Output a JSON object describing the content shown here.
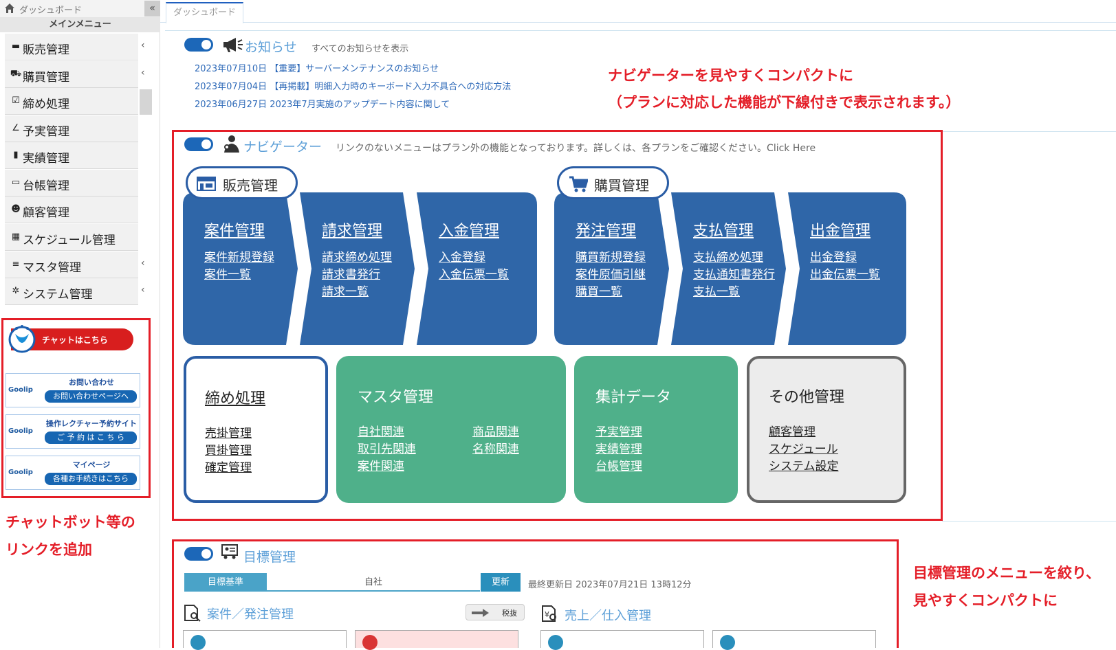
{
  "sidebar": {
    "title": "ダッシュボード",
    "collapse": "«",
    "menu_header": "メインメニュー",
    "items": [
      {
        "label": "販売管理",
        "icon": "sales-icon",
        "glyph": "▬",
        "arrow": "‹"
      },
      {
        "label": "購買管理",
        "icon": "cart-icon",
        "glyph": "⛟",
        "arrow": "‹"
      },
      {
        "label": "締め処理",
        "icon": "checkbox-icon",
        "glyph": "☑",
        "arrow": ""
      },
      {
        "label": "予実管理",
        "icon": "line-chart-icon",
        "glyph": "∠",
        "arrow": ""
      },
      {
        "label": "実績管理",
        "icon": "bookmark-icon",
        "glyph": "▮",
        "arrow": ""
      },
      {
        "label": "台帳管理",
        "icon": "ledger-icon",
        "glyph": "▭",
        "arrow": ""
      },
      {
        "label": "顧客管理",
        "icon": "users-icon",
        "glyph": "☻",
        "arrow": ""
      },
      {
        "label": "スケジュール管理",
        "icon": "calendar-icon",
        "glyph": "▦",
        "arrow": ""
      },
      {
        "label": "マスタ管理",
        "icon": "database-icon",
        "glyph": "≡",
        "arrow": "‹"
      },
      {
        "label": "システム管理",
        "icon": "gear-icon",
        "glyph": "✲",
        "arrow": "‹"
      }
    ],
    "chat_button": "チャットはこちら",
    "goolip": [
      {
        "logo": "Goolip",
        "title": "お問い合わせ",
        "button": "お問い合わせページへ"
      },
      {
        "logo": "Goolip",
        "title": "操作レクチャー予約サイト",
        "button": "ご 予 約 は こ ち ら"
      },
      {
        "logo": "Goolip",
        "title": "マイページ",
        "button": "各種お手続きはこちら"
      }
    ],
    "annotation_lines": [
      "チャットボット等の",
      "リンクを追加"
    ]
  },
  "tabs": {
    "dashboard": "ダッシュボード"
  },
  "notices": {
    "title": "お知らせ",
    "show_all": "すべてのお知らせを表示",
    "items": [
      "2023年07月10日 【重要】サーバーメンテナンスのお知らせ",
      "2023年07月04日 【再掲載】明細入力時のキーボード入力不具合への対応方法",
      "2023年06月27日 2023年7月実施のアップデート内容に関して"
    ]
  },
  "annotation_navigator": [
    "ナビゲーターを見やすくコンパクトに",
    "（プランに対応した機能が下線付きで表示されます。）"
  ],
  "navigator": {
    "title": "ナビゲーター",
    "note": "リンクのないメニューはプラン外の機能となっております。詳しくは、各プランをご確認ください。Click Here",
    "sales": {
      "label": "販売管理",
      "steps": [
        {
          "title": "案件管理",
          "links": [
            "案件新規登録",
            "案件一覧"
          ]
        },
        {
          "title": "請求管理",
          "links": [
            "請求締め処理",
            "請求書発行",
            "請求一覧"
          ]
        },
        {
          "title": "入金管理",
          "links": [
            "入金登録",
            "入金伝票一覧"
          ]
        }
      ]
    },
    "purchase": {
      "label": "購買管理",
      "steps": [
        {
          "title": "発注管理",
          "links": [
            "購買新規登録",
            "案件原価引継",
            "購買一覧"
          ]
        },
        {
          "title": "支払管理",
          "links": [
            "支払締め処理",
            "支払通知書発行",
            "支払一覧"
          ]
        },
        {
          "title": "出金管理",
          "links": [
            "出金登録",
            "出金伝票一覧"
          ]
        }
      ]
    },
    "cards": {
      "closing": {
        "title": "締め処理",
        "links": [
          "売掛管理",
          "買掛管理",
          "確定管理"
        ]
      },
      "master": {
        "title": "マスタ管理",
        "links": [
          "自社関連",
          "取引先関連",
          "案件関連",
          "商品関連",
          "名称関連"
        ]
      },
      "aggregate": {
        "title": "集計データ",
        "links": [
          "予実管理",
          "実績管理",
          "台帳管理"
        ]
      },
      "other": {
        "title": "その他管理",
        "links": [
          "顧客管理",
          "スケジュール",
          "システム設定"
        ]
      }
    }
  },
  "goals": {
    "title": "目標管理",
    "basis_label": "目標基準",
    "company": "自社",
    "update_button": "更新",
    "last_updated": "最終更新日 2023年07月21日 13時12分",
    "project_order_title": "案件／発注管理",
    "tax_toggle": "税抜",
    "sales_purchase_title": "売上／仕入管理"
  },
  "annotation_goals": [
    "目標管理のメニューを絞り、",
    "見やすくコンパクトに"
  ],
  "colors": {
    "nav_blue": "#2f66a8",
    "master_green": "#4fb08a",
    "closing_border": "#2a5da5",
    "other_gray": "#ececec",
    "annotation_red": "#e41e28"
  }
}
